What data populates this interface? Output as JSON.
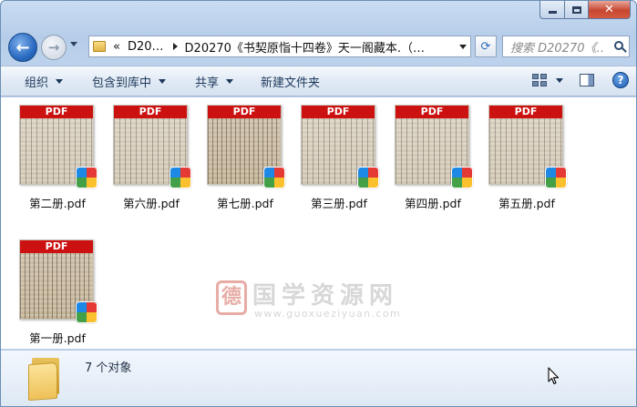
{
  "window": {
    "caption_buttons": {
      "minimize": "minimize",
      "maximize": "maximize",
      "close": "✕"
    }
  },
  "nav": {
    "back_glyph": "←",
    "forward_glyph": "→",
    "address": {
      "overflow": "«",
      "seg1": "D20…",
      "seg2": "D20270《书契原恉十四卷》天一阁藏本.（…"
    },
    "refresh_glyph": "⟳",
    "search_placeholder": "搜索 D20270《…"
  },
  "toolbar": {
    "organize": "组织",
    "include_in_library": "包含到库中",
    "share": "共享",
    "new_folder": "新建文件夹",
    "help": "?"
  },
  "files": [
    {
      "name": "第二册.pdf",
      "badge": "PDF",
      "icon": "pdf-icon"
    },
    {
      "name": "第六册.pdf",
      "badge": "PDF",
      "icon": "pdf-icon"
    },
    {
      "name": "第七册.pdf",
      "badge": "PDF",
      "icon": "pdf-icon"
    },
    {
      "name": "第三册.pdf",
      "badge": "PDF",
      "icon": "pdf-icon"
    },
    {
      "name": "第四册.pdf",
      "badge": "PDF",
      "icon": "pdf-icon"
    },
    {
      "name": "第五册.pdf",
      "badge": "PDF",
      "icon": "pdf-icon"
    },
    {
      "name": "第一册.pdf",
      "badge": "PDF",
      "icon": "pdf-icon"
    }
  ],
  "watermark": {
    "seal": "德",
    "text": "国学资源网",
    "url": "www.guoxueziyuan.com"
  },
  "details": {
    "count": "7 个对象"
  },
  "colors": {
    "pdf_red": "#cc1111",
    "accent_blue": "#2a6bc2"
  }
}
